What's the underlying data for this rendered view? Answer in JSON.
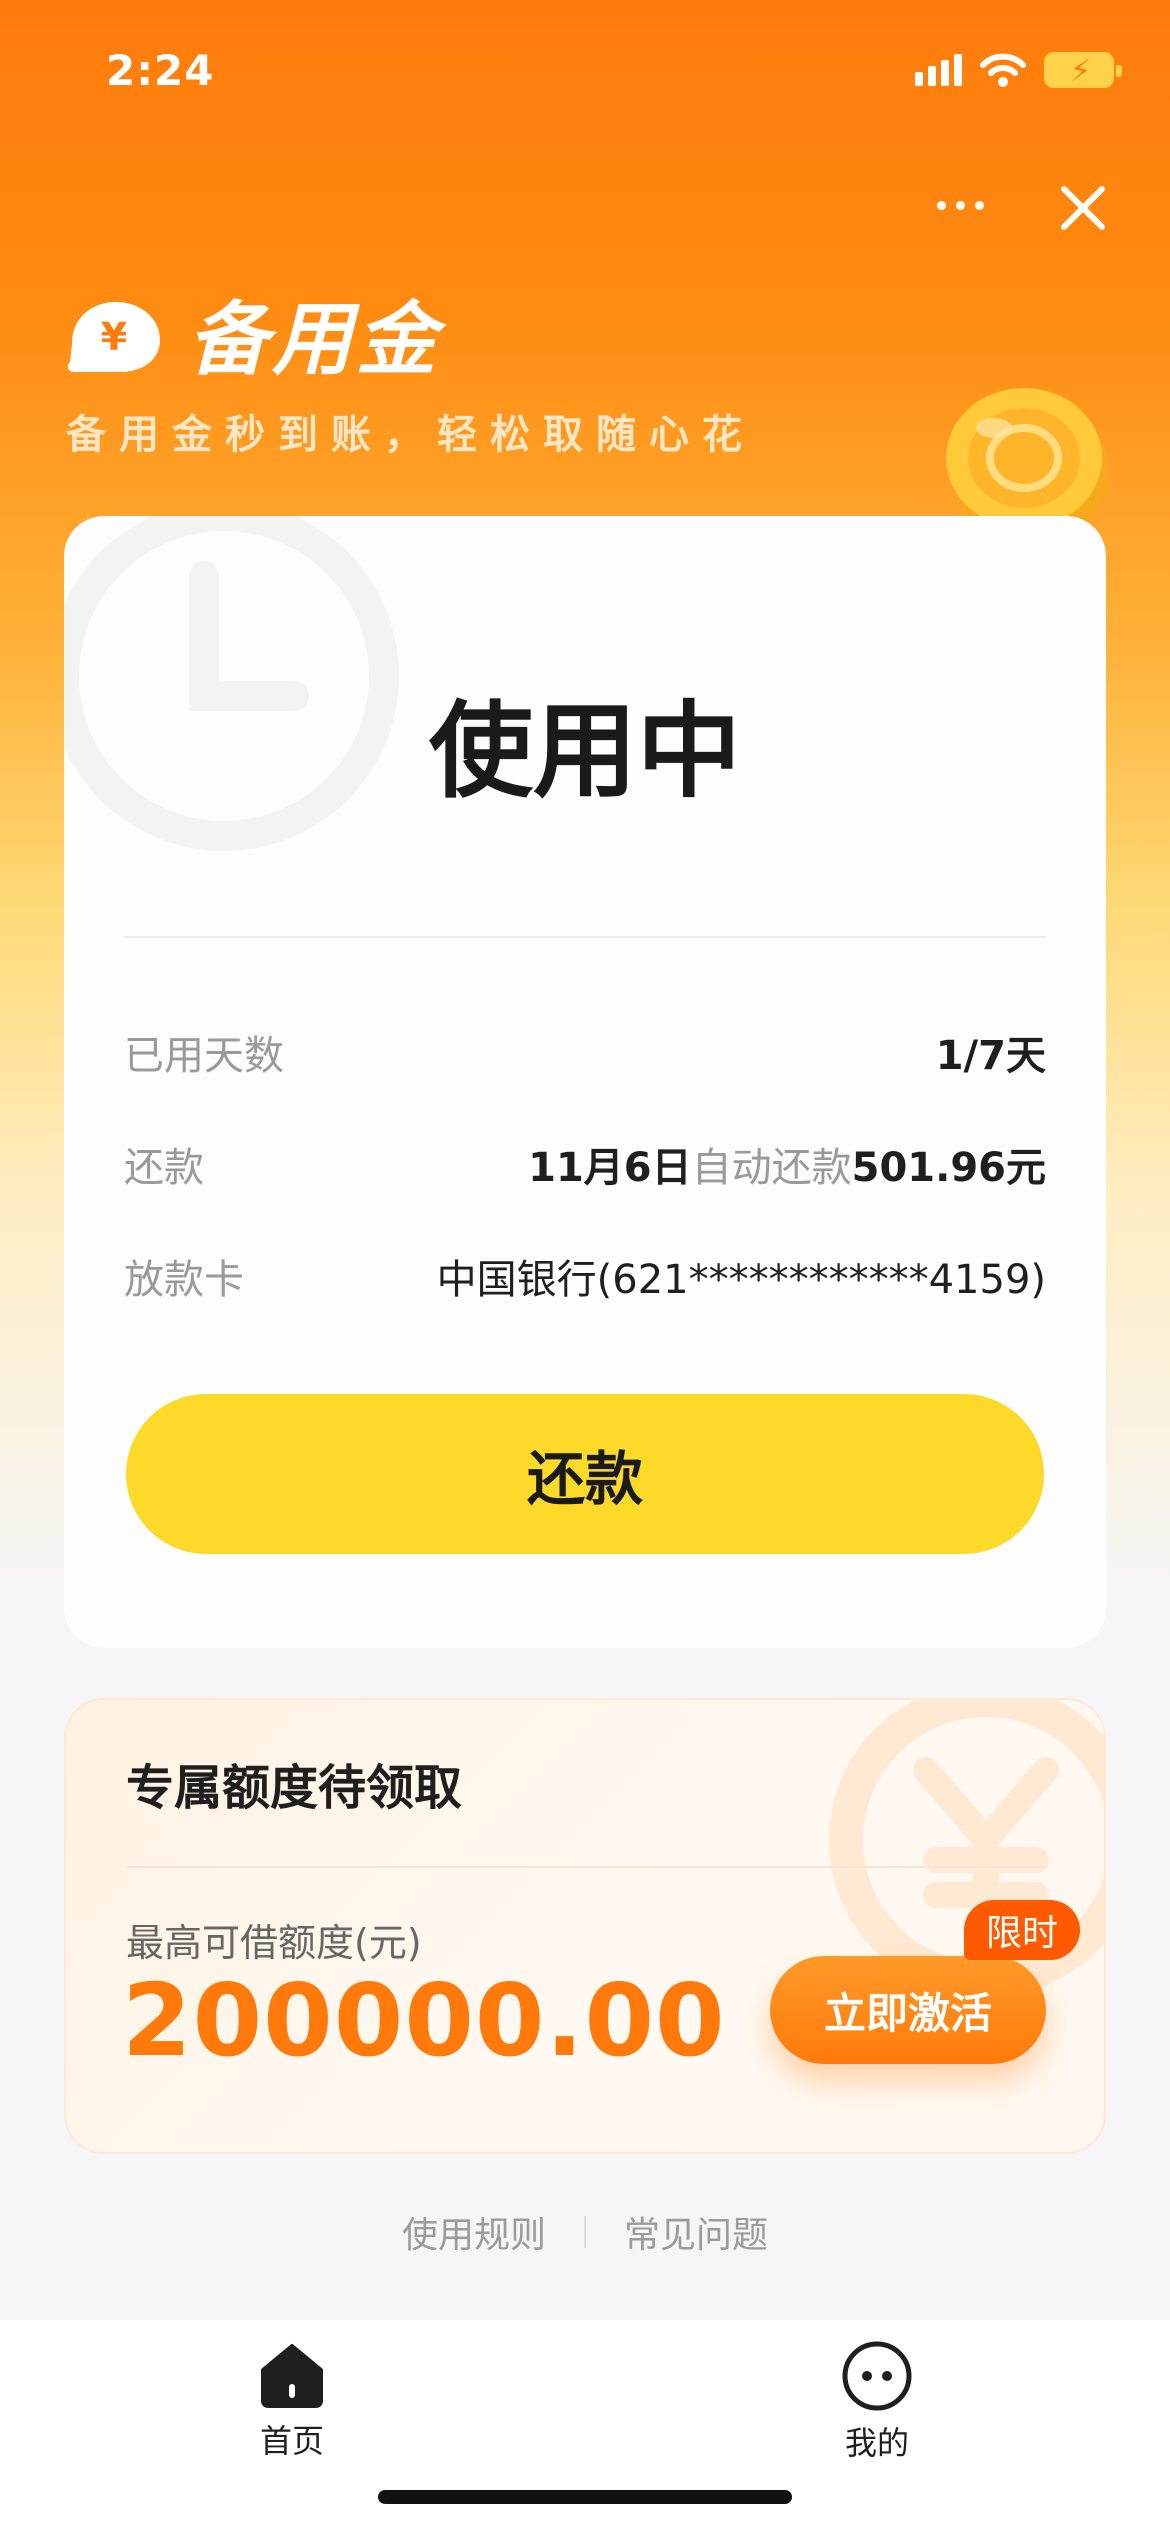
{
  "status_bar": {
    "time": "2:24"
  },
  "header": {
    "brand_title": "备用金",
    "brand_subtitle": "备用金秒到账，轻松取随心花",
    "brand_logo_glyph": "¥"
  },
  "status_card": {
    "state": "使用中",
    "rows": [
      {
        "label": "已用天数",
        "value": "1/7天"
      },
      {
        "label": "还款",
        "date": "11月6日",
        "auto_text": "自动还款",
        "amount": "501.96元"
      },
      {
        "label": "放款卡",
        "value": "中国银行(621************4159)"
      }
    ],
    "repay_button": "还款"
  },
  "quota_card": {
    "title": "专属额度待领取",
    "label": "最高可借额度(元)",
    "amount": "200000.00",
    "activate_button": "立即激活",
    "badge": "限时"
  },
  "footer_links": [
    "使用规则",
    "常见问题"
  ],
  "tab_bar": [
    {
      "label": "首页",
      "icon": "home-icon",
      "active": true
    },
    {
      "label": "我的",
      "icon": "profile-face-icon",
      "active": false
    }
  ],
  "colors": {
    "accent_orange": "#ff7a0a",
    "repay_yellow": "#fdd92a",
    "badge_red": "#ff5a00"
  }
}
